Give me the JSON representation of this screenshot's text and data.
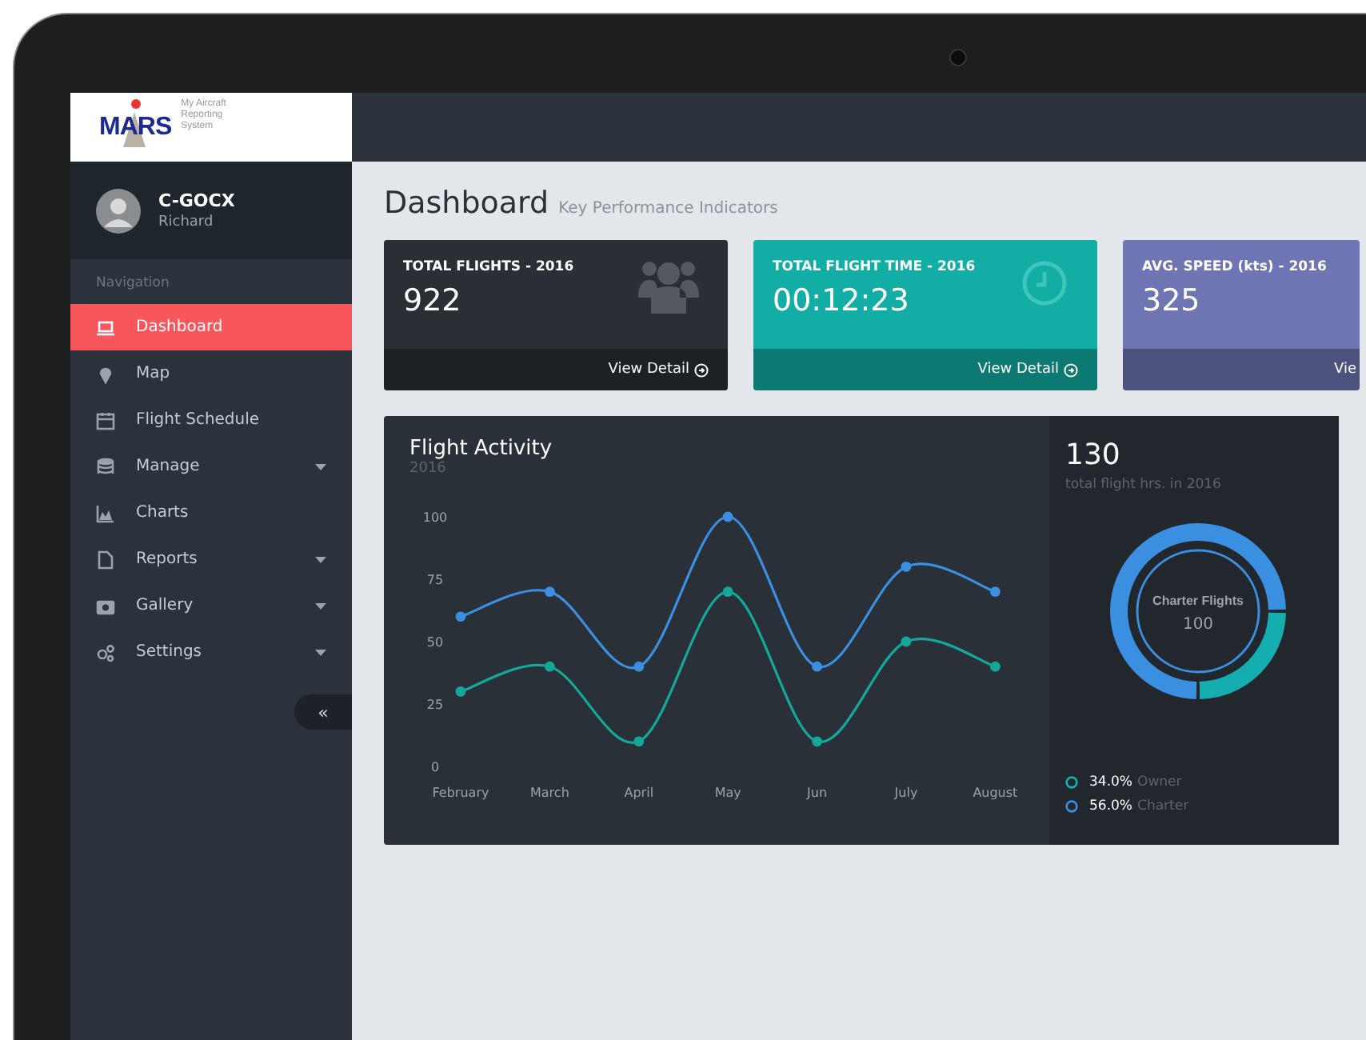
{
  "logo": {
    "name": "MARS",
    "tagline": "My Aircraft Reporting System"
  },
  "user": {
    "name": "C-GOCX",
    "role": "Richard"
  },
  "sidebar": {
    "heading": "Navigation",
    "collapse": "«",
    "items": [
      {
        "label": "Dashboard",
        "kind": "laptop",
        "selected": true,
        "expandable": false
      },
      {
        "label": "Map",
        "kind": "pin",
        "selected": false,
        "expandable": false
      },
      {
        "label": "Flight Schedule",
        "kind": "calendar",
        "selected": false,
        "expandable": false
      },
      {
        "label": "Manage",
        "kind": "database",
        "selected": false,
        "expandable": true
      },
      {
        "label": "Charts",
        "kind": "chart",
        "selected": false,
        "expandable": false
      },
      {
        "label": "Reports",
        "kind": "file",
        "selected": false,
        "expandable": true
      },
      {
        "label": "Gallery",
        "kind": "camera",
        "selected": false,
        "expandable": true
      },
      {
        "label": "Settings",
        "kind": "gears",
        "selected": false,
        "expandable": true
      }
    ]
  },
  "page": {
    "title": "Dashboard",
    "subtitle": "Key Performance Indicators"
  },
  "stats": [
    {
      "label": "TOTAL FLIGHTS - 2016",
      "value": "922",
      "link": "View Detail",
      "kind": "users",
      "color": "#2a2f36"
    },
    {
      "label": "TOTAL FLIGHT TIME - 2016",
      "value": "00:12:23",
      "link": "View Detail",
      "kind": "clock",
      "color": "#12aea5"
    },
    {
      "label": "AVG. SPEED (kts) - 2016",
      "value": "325",
      "link": "Vie",
      "kind": "plain",
      "color": "#6f74b3"
    }
  ],
  "activity": {
    "title": "Flight Activity",
    "year": "2016",
    "chart_data": {
      "type": "line",
      "categories": [
        "February",
        "March",
        "April",
        "May",
        "Jun",
        "July",
        "August"
      ],
      "yticks": [
        0,
        25,
        50,
        75,
        100
      ],
      "ylim": [
        0,
        100
      ],
      "series": [
        {
          "color": "#3b8fe0",
          "marker": true,
          "values": [
            60,
            70,
            40,
            100,
            40,
            80,
            70
          ]
        },
        {
          "color": "#14a89a",
          "marker": true,
          "values": [
            30,
            40,
            10,
            70,
            10,
            50,
            40
          ]
        }
      ]
    }
  },
  "summary": {
    "total": "130",
    "caption": "total flight hrs. in 2016",
    "center_title": "Charter Flights",
    "center_value": "100",
    "legend": [
      {
        "percent": "34.0%",
        "label": "Owner",
        "color": "#14aeb0"
      },
      {
        "percent": "56.0%",
        "label": "Charter",
        "color": "#3b8fe0"
      }
    ]
  }
}
